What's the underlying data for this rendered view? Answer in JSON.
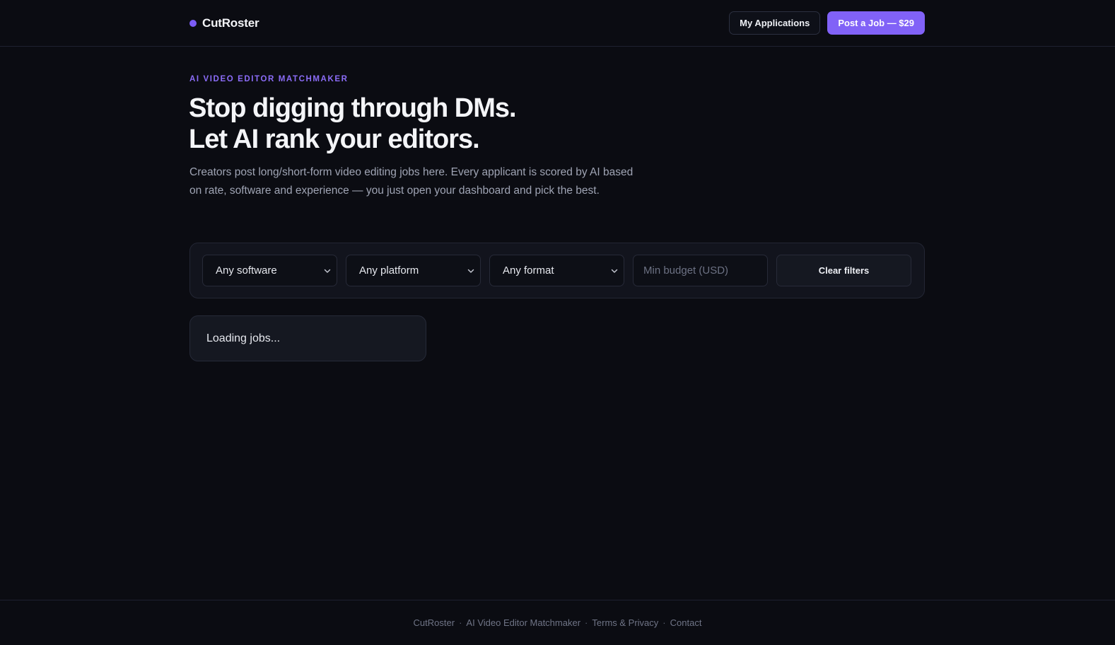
{
  "brand": {
    "name": "CutRoster",
    "accent_color": "#7c5cf6"
  },
  "nav": {
    "my_applications": "My Applications",
    "post_job": "Post a Job — $29"
  },
  "hero": {
    "eyebrow": "AI VIDEO EDITOR MATCHMAKER",
    "headline_line1": "Stop digging through DMs.",
    "headline_line2": "Let AI rank your editors.",
    "subcopy": "Creators post long/short-form video editing jobs here. Every applicant is scored by AI based on rate, software and experience — you just open your dashboard and pick the best."
  },
  "filters": {
    "software": "Any software",
    "platform": "Any platform",
    "format": "Any format",
    "min_budget_placeholder": "Min budget (USD)",
    "clear_label": "Clear filters"
  },
  "jobs": {
    "loading_text": "Loading jobs..."
  },
  "footer": {
    "brand": "CutRoster",
    "tagline": "AI Video Editor Matchmaker",
    "terms": "Terms & Privacy",
    "contact": "Contact",
    "separator": "·"
  }
}
